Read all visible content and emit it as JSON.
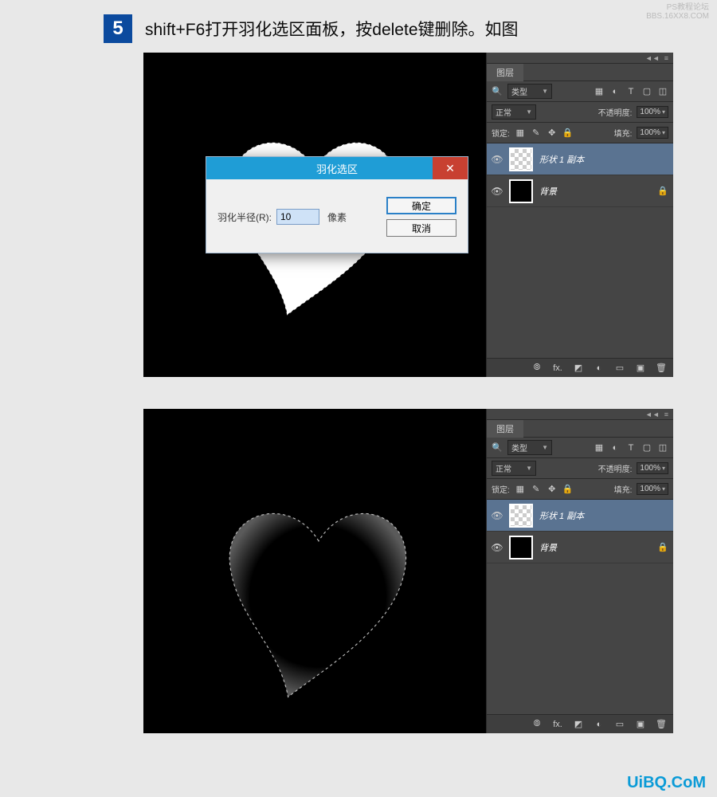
{
  "watermark": {
    "line1": "PS教程论坛",
    "line2": "BBS.16XX8.COM",
    "bottom": "UiBQ.CoM"
  },
  "step": {
    "number": "5",
    "text": "shift+F6打开羽化选区面板，按delete键删除。如图"
  },
  "dialog": {
    "title": "羽化选区",
    "field_label": "羽化半径(R):",
    "value": "10",
    "unit": "像素",
    "ok": "确定",
    "cancel": "取消"
  },
  "layers": {
    "collapse_icon": "◄◄",
    "menu_icon": "≡",
    "tab": "图层",
    "filter_label": "类型",
    "filter_icons": {
      "image": "▦",
      "adjust": "◐",
      "text": "T",
      "shape": "▢",
      "smart": "◫"
    },
    "blend_mode": "正常",
    "opacity_label": "不透明度:",
    "opacity_value": "100%",
    "lock_label": "锁定:",
    "lock_icons": {
      "trans": "▦",
      "brush": "✎",
      "move": "✥",
      "all": "🔒"
    },
    "fill_label": "填充:",
    "fill_value": "100%",
    "layer1": "形状 1 副本",
    "layer_bg": "背景",
    "footer_icons": {
      "link": "⦾",
      "fx": "fx.",
      "mask": "◩",
      "adjust": "◐",
      "folder": "▭",
      "new": "▣",
      "trash": "🗑"
    }
  }
}
